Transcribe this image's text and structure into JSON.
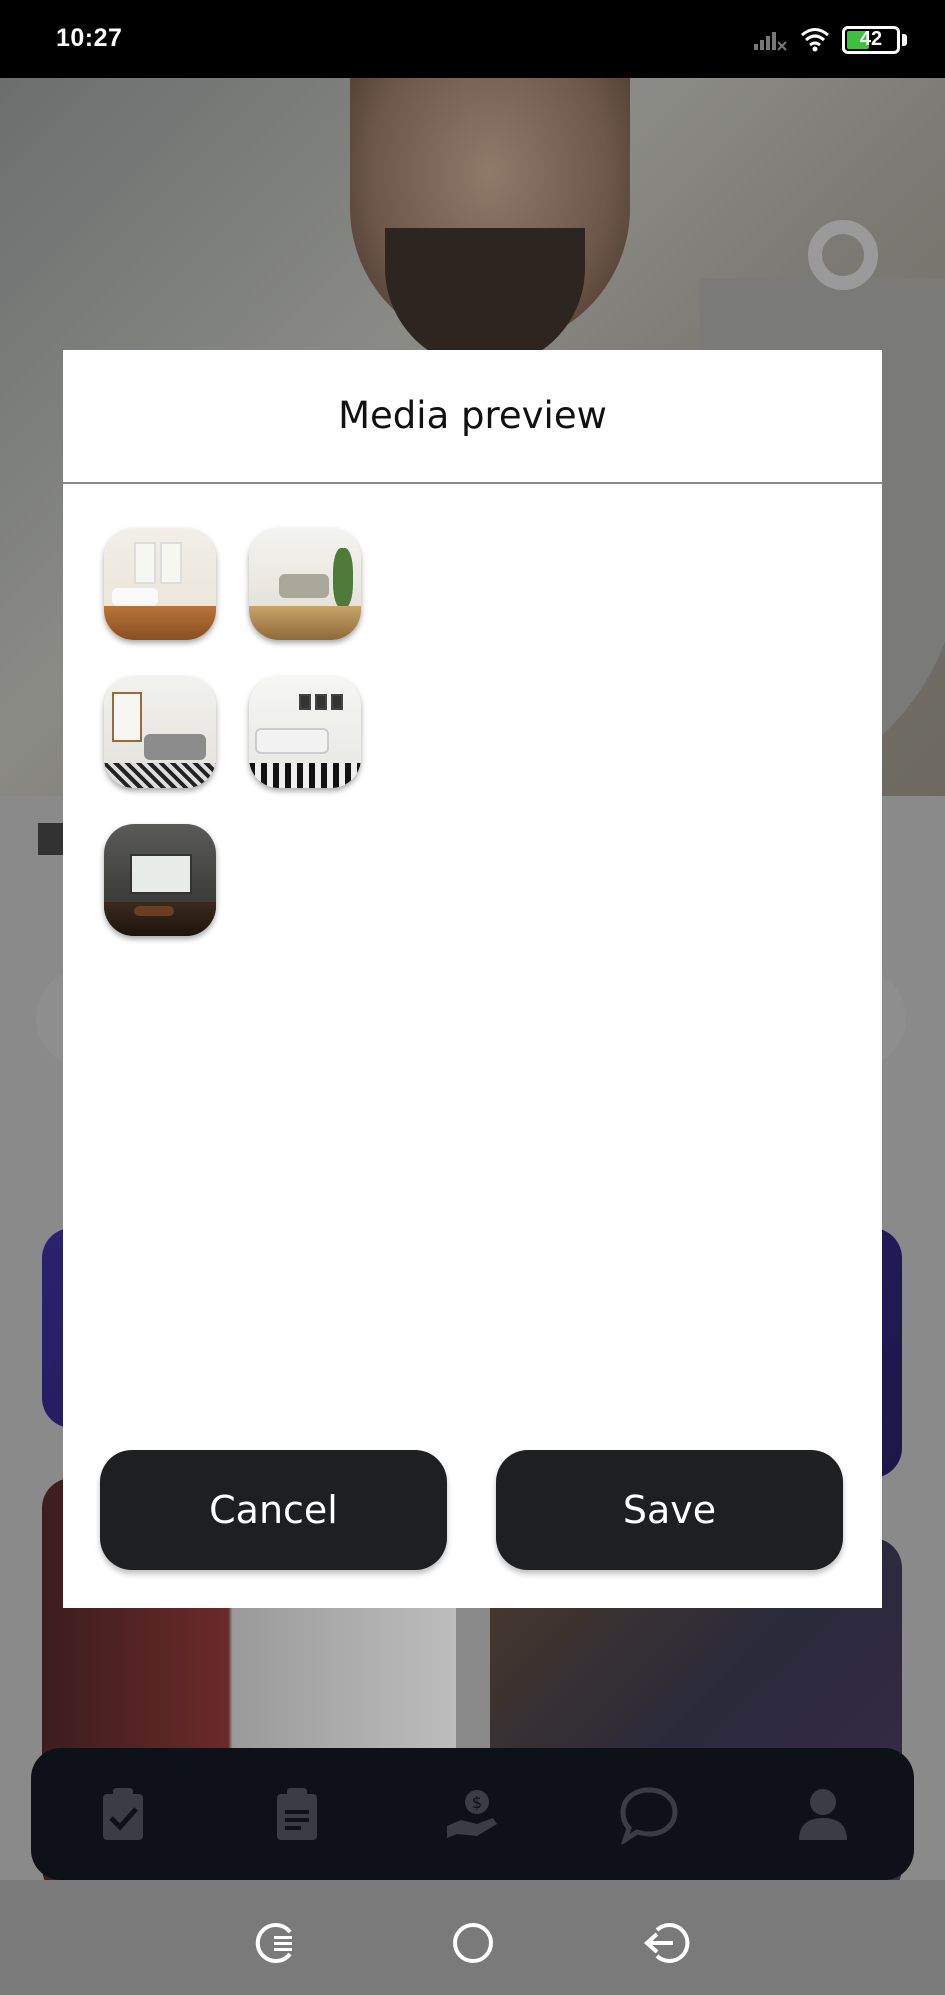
{
  "status_bar": {
    "time": "10:27",
    "battery_level": "42"
  },
  "modal": {
    "title": "Media preview",
    "media": [
      {
        "name": "room-photo-1",
        "icon": "image-thumbnail"
      },
      {
        "name": "room-photo-2",
        "icon": "image-thumbnail"
      },
      {
        "name": "room-photo-3",
        "icon": "image-thumbnail"
      },
      {
        "name": "room-photo-4",
        "icon": "image-thumbnail"
      },
      {
        "name": "room-photo-5",
        "icon": "image-thumbnail"
      }
    ],
    "cancel_label": "Cancel",
    "save_label": "Save"
  },
  "bottom_nav": {
    "items": [
      "clipboard-check-icon",
      "clipboard-list-icon",
      "hand-money-icon",
      "chat-bubble-icon",
      "user-icon"
    ]
  },
  "system_nav": {
    "items": [
      "recents-icon",
      "home-icon",
      "back-icon"
    ]
  },
  "colors": {
    "modal_bg": "#ffffff",
    "button_bg": "#1d1f21",
    "button_text": "#ffffff",
    "nav_bg": "#0e1118",
    "battery_fill": "#3fbf3f"
  }
}
